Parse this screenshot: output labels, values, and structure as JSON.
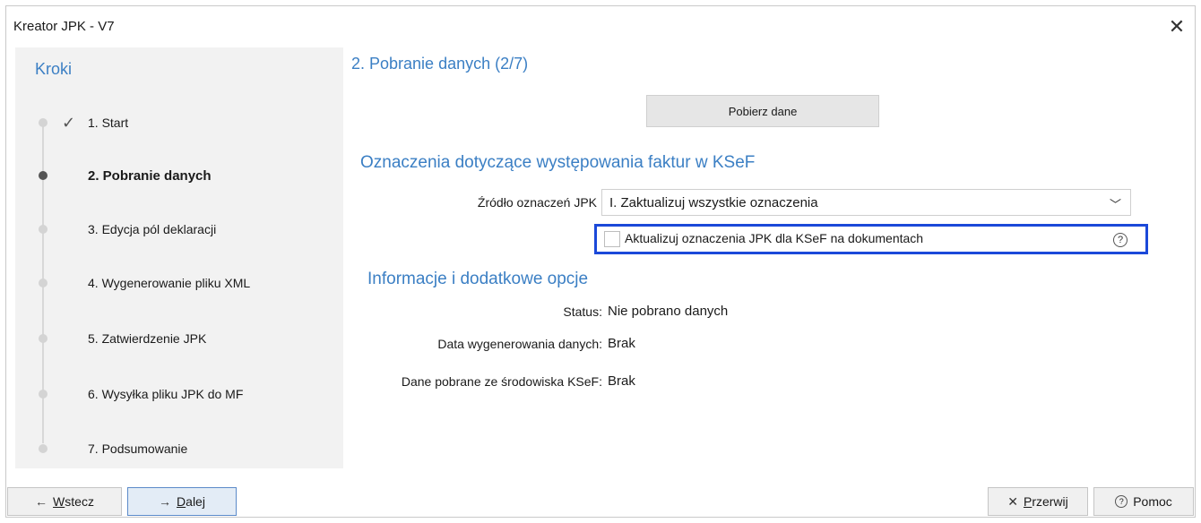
{
  "window": {
    "title": "Kreator JPK - V7"
  },
  "sidebar": {
    "title": "Kroki",
    "steps": [
      {
        "label": "1. Start",
        "state": "done"
      },
      {
        "label": "2. Pobranie danych",
        "state": "active"
      },
      {
        "label": "3. Edycja pól deklaracji",
        "state": "pending"
      },
      {
        "label": "4. Wygenerowanie pliku XML",
        "state": "pending"
      },
      {
        "label": "5. Zatwierdzenie JPK",
        "state": "pending"
      },
      {
        "label": "6. Wysyłka pliku JPK do MF",
        "state": "pending"
      },
      {
        "label": "7. Podsumowanie",
        "state": "pending"
      }
    ]
  },
  "main": {
    "title": "2. Pobranie danych (2/7)",
    "fetch_button": "Pobierz dane",
    "ksef_section": {
      "title": "Oznaczenia dotyczące występowania faktur w KSeF",
      "source_label": "Źródło oznaczeń JPK",
      "source_value": "I.  Zaktualizuj wszystkie oznaczenia",
      "update_checkbox_label": "Aktualizuj oznaczenia JPK dla KSeF na dokumentach",
      "update_checkbox_checked": false
    },
    "info_section": {
      "title": "Informacje i dodatkowe opcje",
      "status_label": "Status:",
      "status_value": "Nie pobrano danych",
      "date_label": "Data wygenerowania danych:",
      "date_value": "Brak",
      "ksef_label": "Dane pobrane ze środowiska KSeF:",
      "ksef_value": "Brak"
    }
  },
  "footer": {
    "back_label": "Wstecz",
    "back_accel": "W",
    "back_rest": "stecz",
    "next_label": "Dalej",
    "next_accel": "D",
    "next_rest": "alej",
    "cancel_label": "Przerwij",
    "cancel_accel": "P",
    "cancel_rest": "rzerwij",
    "help_label": "Pomoc"
  },
  "icons": {
    "close": "close-icon",
    "check": "checkmark-icon",
    "chevron": "chevron-down-icon",
    "help": "help-circle-icon",
    "arrow_left": "arrow-left-icon",
    "arrow_right": "arrow-right-icon"
  },
  "colors": {
    "accent": "#3b7fc4",
    "highlight": "#1b49d9",
    "sidebar_bg": "#f2f2f2"
  }
}
